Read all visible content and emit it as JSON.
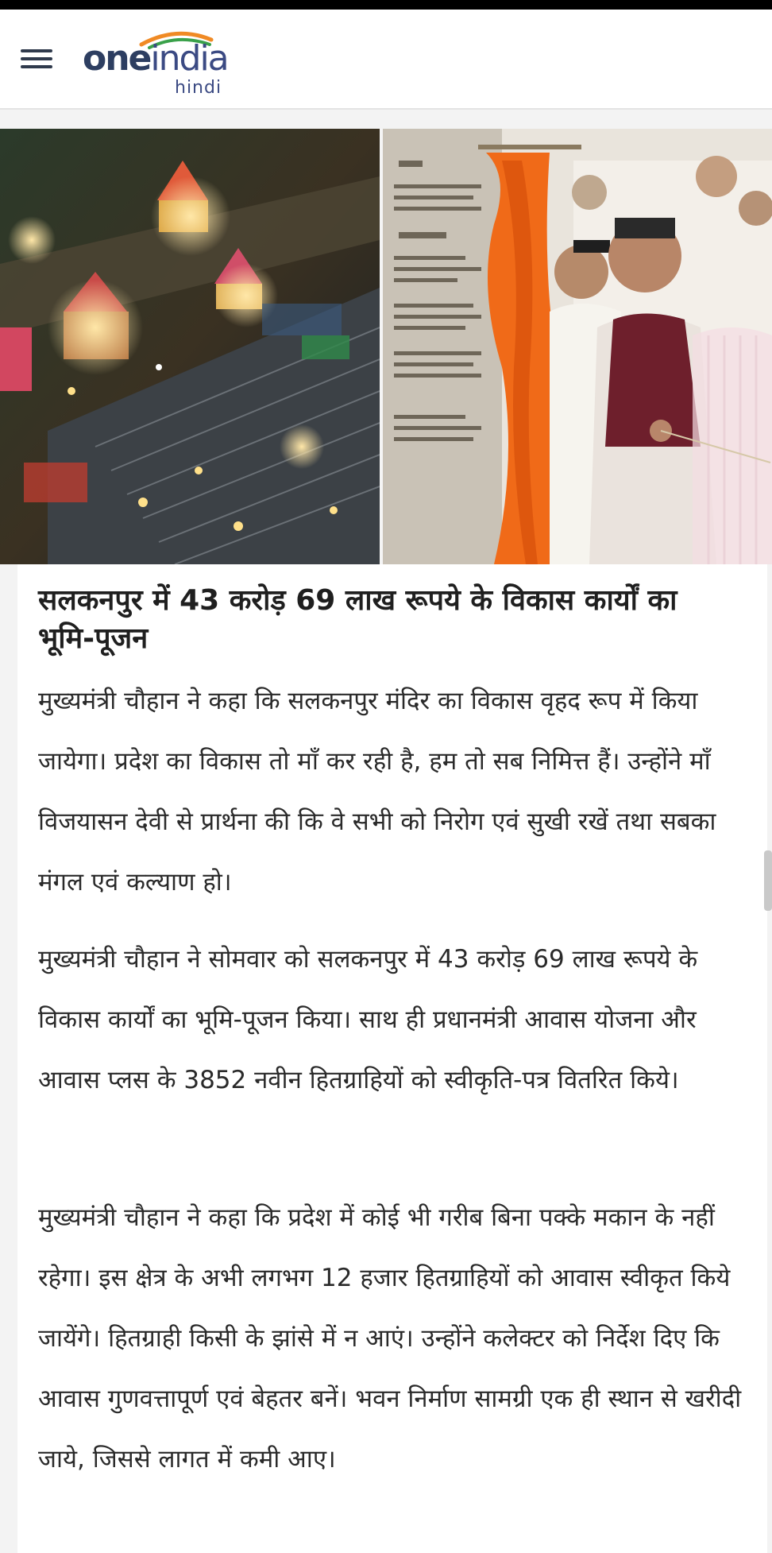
{
  "header": {
    "logo_brand_one": "one",
    "logo_brand_india": "india",
    "logo_sub": "hindi"
  },
  "hero": {
    "left_image_alt": "aerial night view of temple complex",
    "right_image_alt": "chief minister unveiling plaque"
  },
  "article": {
    "headline": "सलकनपुर में 43 करोड़ 69 लाख रूपये के विकास कार्यों का भूमि-पूजन",
    "paragraphs": [
      "मुख्यमंत्री चौहान ने कहा कि सलकनपुर मंदिर का विकास वृहद रूप में किया जायेगा। प्रदेश का विकास तो माँ कर रही है, हम तो सब निमित्त हैं। उन्होंने माँ विजयासन देवी से प्रार्थना की कि वे सभी को निरोग एवं सुखी रखें तथा सबका मंगल एवं कल्याण हो।",
      "मुख्यमंत्री चौहान ने सोमवार को सलकनपुर में 43 करोड़ 69 लाख रूपये के विकास कार्यों का भूमि-पूजन किया। साथ ही प्रधानमंत्री आवास योजना और आवास प्लस के 3852 नवीन हितग्राहियों को स्वीकृति-पत्र वितरित किये।",
      "मुख्यमंत्री चौहान ने कहा कि प्रदेश में कोई भी गरीब बिना पक्के मकान के नहीं रहेगा। इस क्षेत्र के अभी लगभग 12 हजार हितग्राहियों को आवास स्वीकृत किये जायेंगे। हितग्राही किसी के झांसे में न आएं। उन्होंने कलेक्टर को निर्देश दिए कि आवास गुणवत्तापूर्ण एवं बेहतर बनें। भवन निर्माण सामग्री एक ही स्थान से खरीदी जाये, जिससे लागत में कमी आए।"
    ]
  },
  "colors": {
    "logo_dark": "#2d3e61",
    "logo_arc_saffron": "#f08a24",
    "logo_arc_green": "#3aa14a",
    "text": "#2a2a2a"
  }
}
